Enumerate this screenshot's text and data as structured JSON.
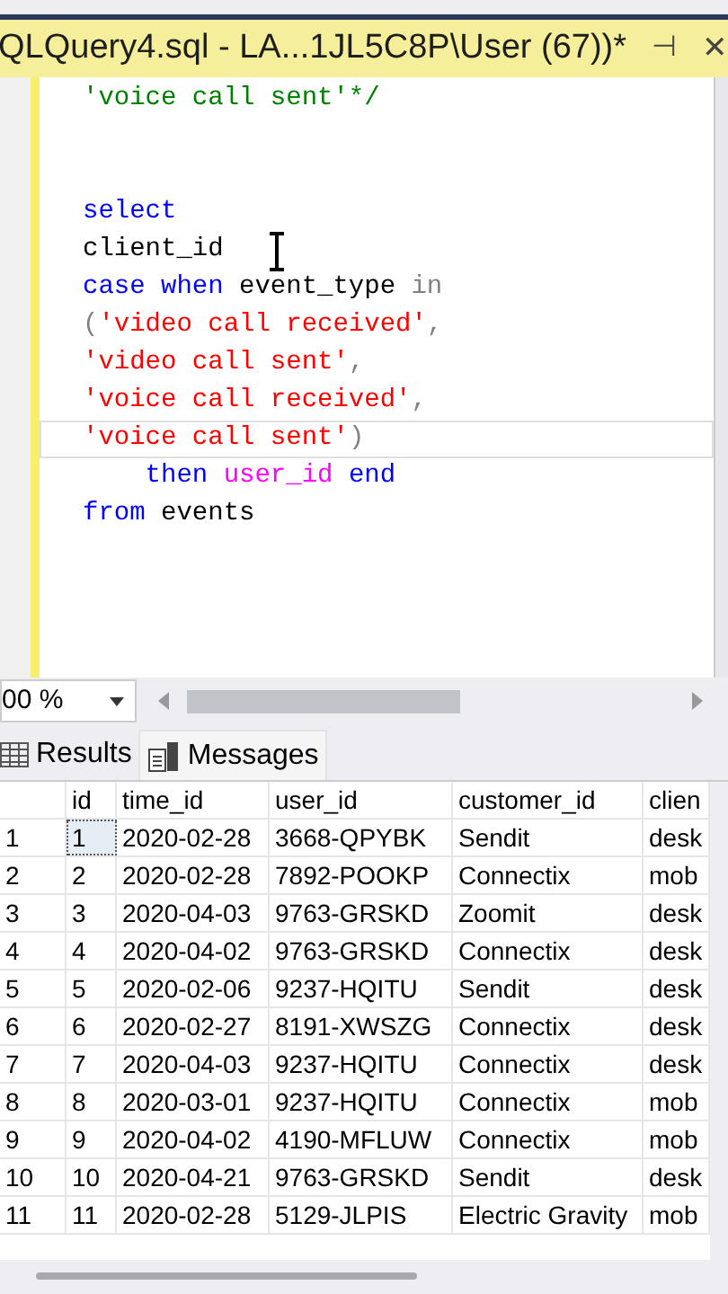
{
  "document_tab": {
    "title": "QLQuery4.sql - LA...1JL5C8P\\User (67))*",
    "pin": "⊣",
    "close": "✕"
  },
  "editor": {
    "lines": [
      {
        "current": false,
        "tokens": [
          {
            "kind": "comment",
            "text": "'voice call sent'*/"
          }
        ]
      },
      {
        "current": false
      },
      {
        "current": false
      },
      {
        "current": false,
        "tokens": [
          {
            "kind": "keyword",
            "text": "select"
          }
        ]
      },
      {
        "current": false,
        "tokens": [
          {
            "kind": "plain",
            "text": "client_id"
          }
        ]
      },
      {
        "current": false,
        "tokens": [
          {
            "kind": "keyword",
            "text": "case when "
          },
          {
            "kind": "plain",
            "text": "event_type "
          },
          {
            "kind": "operator",
            "text": "in"
          }
        ]
      },
      {
        "current": false,
        "tokens": [
          {
            "kind": "operator",
            "text": "("
          },
          {
            "kind": "string",
            "text": "'video call received'"
          },
          {
            "kind": "operator",
            "text": ","
          }
        ]
      },
      {
        "current": false,
        "tokens": [
          {
            "kind": "string",
            "text": "'video call sent'"
          },
          {
            "kind": "operator",
            "text": ","
          }
        ]
      },
      {
        "current": false,
        "tokens": [
          {
            "kind": "string",
            "text": "'voice call received'"
          },
          {
            "kind": "operator",
            "text": ","
          }
        ]
      },
      {
        "current": true,
        "tokens": [
          {
            "kind": "string",
            "text": "'voice call sent'"
          },
          {
            "kind": "operator",
            "text": ")"
          }
        ]
      },
      {
        "current": false,
        "tokens": [
          {
            "kind": "keyword",
            "text": "    then "
          },
          {
            "kind": "function",
            "text": "user_id"
          },
          {
            "kind": "keyword",
            "text": " end"
          }
        ]
      },
      {
        "current": false,
        "tokens": [
          {
            "kind": "keyword",
            "text": "from "
          },
          {
            "kind": "plain",
            "text": "events"
          }
        ]
      }
    ]
  },
  "zoom": {
    "value": "00 %"
  },
  "result_tabs": [
    {
      "label": "Results",
      "kind": "grid",
      "selected": true
    },
    {
      "label": "Messages",
      "kind": "messages",
      "selected": false
    }
  ],
  "table": {
    "columns": [
      "id",
      "time_id",
      "user_id",
      "customer_id",
      "clien"
    ],
    "rows": [
      {
        "number": "1",
        "selected": true,
        "cells": [
          "1",
          "2020-02-28",
          "3668-QPYBK",
          "Sendit",
          "desk"
        ]
      },
      {
        "number": "2",
        "selected": false,
        "cells": [
          "2",
          "2020-02-28",
          "7892-POOKP",
          "Connectix",
          "mob"
        ]
      },
      {
        "number": "3",
        "selected": false,
        "cells": [
          "3",
          "2020-04-03",
          "9763-GRSKD",
          "Zoomit",
          "desk"
        ]
      },
      {
        "number": "4",
        "selected": false,
        "cells": [
          "4",
          "2020-04-02",
          "9763-GRSKD",
          "Connectix",
          "desk"
        ]
      },
      {
        "number": "5",
        "selected": false,
        "cells": [
          "5",
          "2020-02-06",
          "9237-HQITU",
          "Sendit",
          "desk"
        ]
      },
      {
        "number": "6",
        "selected": false,
        "cells": [
          "6",
          "2020-02-27",
          "8191-XWSZG",
          "Connectix",
          "desk"
        ]
      },
      {
        "number": "7",
        "selected": false,
        "cells": [
          "7",
          "2020-04-03",
          "9237-HQITU",
          "Connectix",
          "desk"
        ]
      },
      {
        "number": "8",
        "selected": false,
        "cells": [
          "8",
          "2020-03-01",
          "9237-HQITU",
          "Connectix",
          "mob"
        ]
      },
      {
        "number": "9",
        "selected": false,
        "cells": [
          "9",
          "2020-04-02",
          "4190-MFLUW",
          "Connectix",
          "mob"
        ]
      },
      {
        "number": "10",
        "selected": false,
        "cells": [
          "10",
          "2020-04-21",
          "9763-GRSKD",
          "Sendit",
          "desk"
        ]
      },
      {
        "number": "11",
        "selected": false,
        "cells": [
          "11",
          "2020-02-28",
          "5129-JLPIS",
          "Electric Gravity",
          "mob"
        ]
      }
    ]
  }
}
